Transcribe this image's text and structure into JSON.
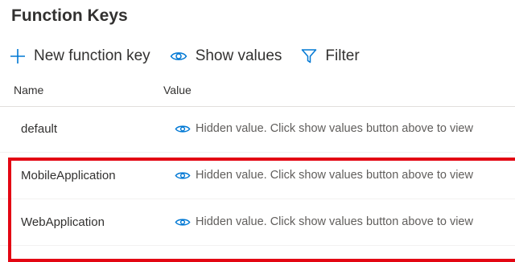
{
  "page": {
    "title": "Function Keys"
  },
  "toolbar": {
    "new_key": "New function key",
    "show_values": "Show values",
    "filter": "Filter"
  },
  "table": {
    "columns": [
      "Name",
      "Value"
    ],
    "rows": [
      {
        "name": "default",
        "value": "Hidden value. Click show values button above to view"
      },
      {
        "name": "MobileApplication",
        "value": "Hidden value. Click show values button above to view"
      },
      {
        "name": "WebApplication",
        "value": "Hidden value. Click show values button above to view"
      }
    ]
  },
  "colors": {
    "accent": "#0078d4",
    "highlight": "#e30613"
  },
  "icons": {
    "new_key": "plus-icon",
    "show_values": "eye-icon",
    "filter": "filter-icon",
    "value": "eye-icon"
  }
}
